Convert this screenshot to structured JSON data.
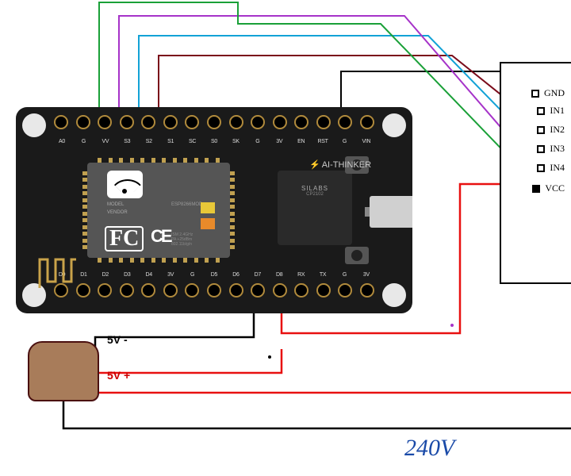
{
  "board": {
    "model_line1": "MODEL",
    "model_line2": "VENDOR",
    "chip_id": "ESP8266MOD",
    "antenna_label": "ANTENNA",
    "ism": "ISM 2.4GHz",
    "pa": "PA +25dBm",
    "rate": "802.11b/g/n",
    "fcc": "FC",
    "ce": "CE",
    "silabs": "SILABS",
    "silabs_part": "CP2102",
    "lightning": "AI-THINKER",
    "top_pins": [
      "A0",
      "G",
      "VV",
      "S3",
      "S2",
      "S1",
      "SC",
      "S0",
      "SK",
      "G",
      "3V",
      "EN",
      "RST",
      "G",
      "VIN"
    ],
    "bot_pins": [
      "D0",
      "D1",
      "D2",
      "D3",
      "D4",
      "3V",
      "G",
      "D5",
      "D6",
      "D7",
      "D8",
      "RX",
      "TX",
      "G",
      "3V"
    ]
  },
  "relay": {
    "gnd": "GND",
    "in1": "IN1",
    "in2": "IN2",
    "in3": "IN3",
    "in4": "IN4",
    "vcc": "VCC"
  },
  "power": {
    "neg": "5V -",
    "pos": "5V +"
  },
  "mains": "240V",
  "wire_colors": {
    "gnd": "#000000",
    "in1": "#7a0b1a",
    "in2": "#12a2d6",
    "in3": "#a633c9",
    "in4": "#1aa038",
    "vcc": "#e81010",
    "pwr_neg": "#000000",
    "pwr_pos": "#e81010",
    "mains_n": "#000000",
    "mains_l": "#e81010"
  }
}
